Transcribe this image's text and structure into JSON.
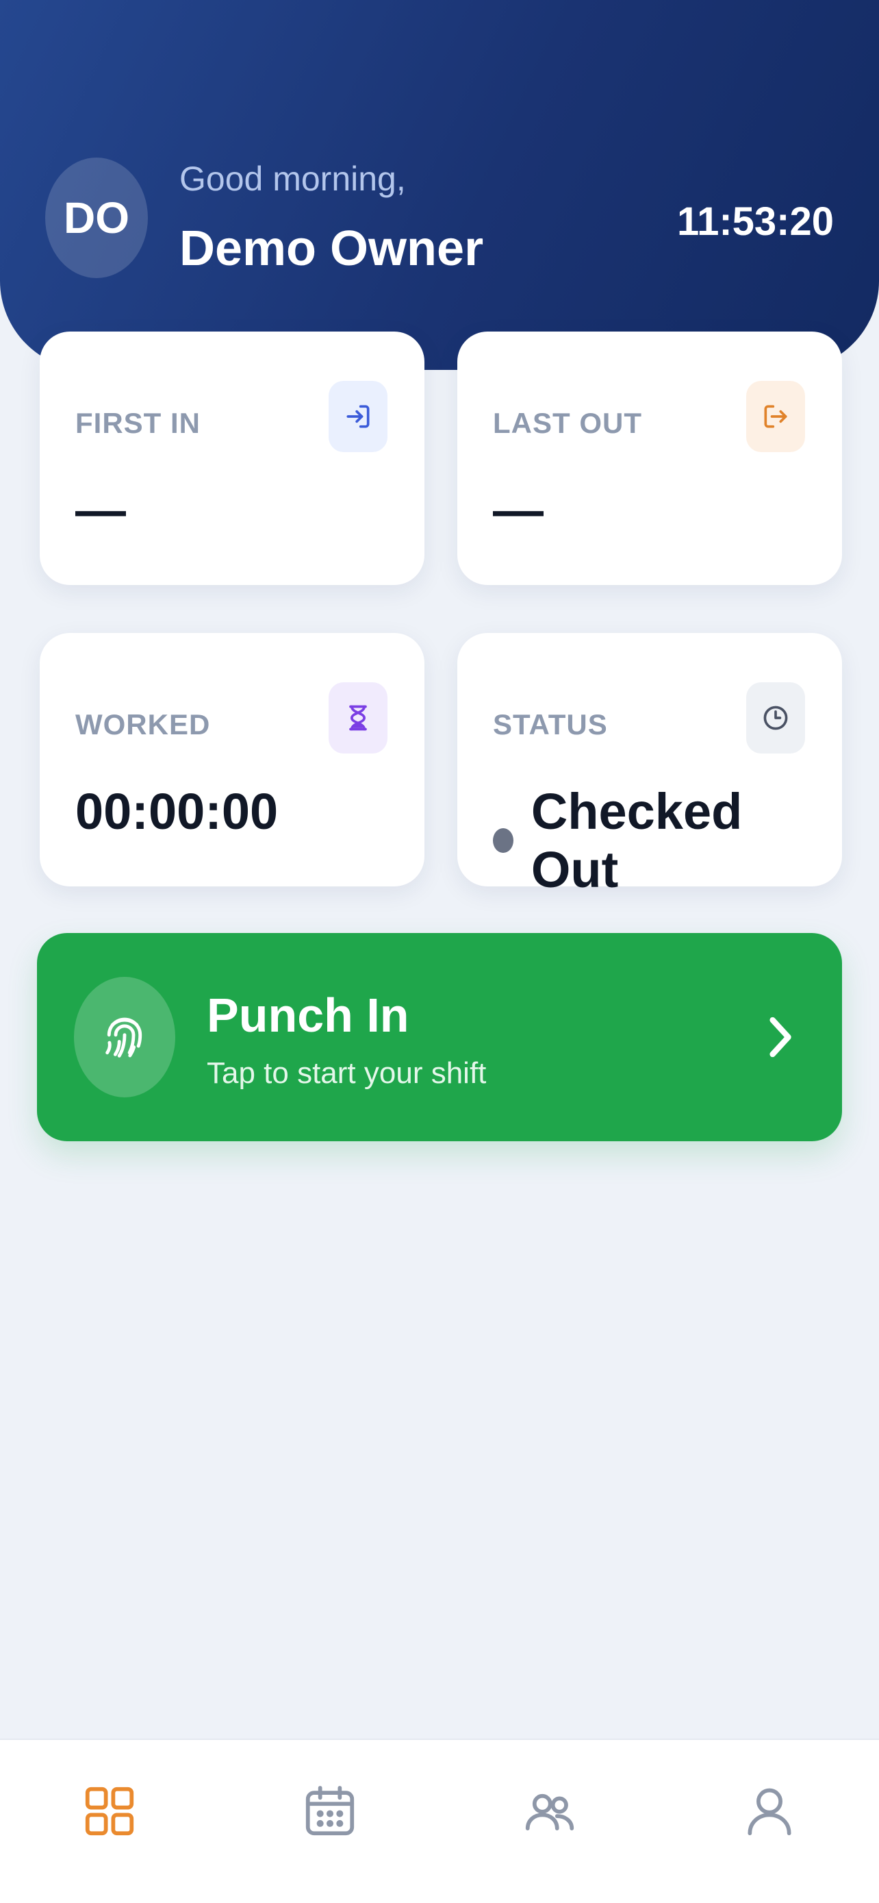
{
  "header": {
    "avatar_initials": "DO",
    "greeting": "Good morning,",
    "user_name": "Demo Owner",
    "clock": "11:53:20"
  },
  "stats": {
    "first_in": {
      "label": "FIRST IN",
      "value": "—",
      "icon": "login-icon",
      "icon_color": "#3b5bd9",
      "icon_bg": "#eaf0fe"
    },
    "last_out": {
      "label": "LAST OUT",
      "value": "—",
      "icon": "logout-icon",
      "icon_color": "#e0822a",
      "icon_bg": "#fdf0e4"
    },
    "worked": {
      "label": "WORKED",
      "value": "00:00:00",
      "icon": "hourglass-icon",
      "icon_color": "#7b3fe4",
      "icon_bg": "#f1ebfd"
    },
    "status": {
      "label": "STATUS",
      "value": "Checked Out",
      "icon": "clock-icon",
      "icon_color": "#4a5264",
      "icon_bg": "#eef1f5"
    }
  },
  "punch": {
    "title": "Punch In",
    "subtitle": "Tap to start your shift",
    "icon": "fingerprint-icon",
    "color": "#1fa64b"
  },
  "nav": {
    "items": [
      {
        "icon": "grid-icon",
        "active": true
      },
      {
        "icon": "calendar-icon",
        "active": false
      },
      {
        "icon": "team-icon",
        "active": false
      },
      {
        "icon": "profile-icon",
        "active": false
      }
    ],
    "active_color": "#ea8a2e",
    "inactive_color": "#8e97a8"
  }
}
